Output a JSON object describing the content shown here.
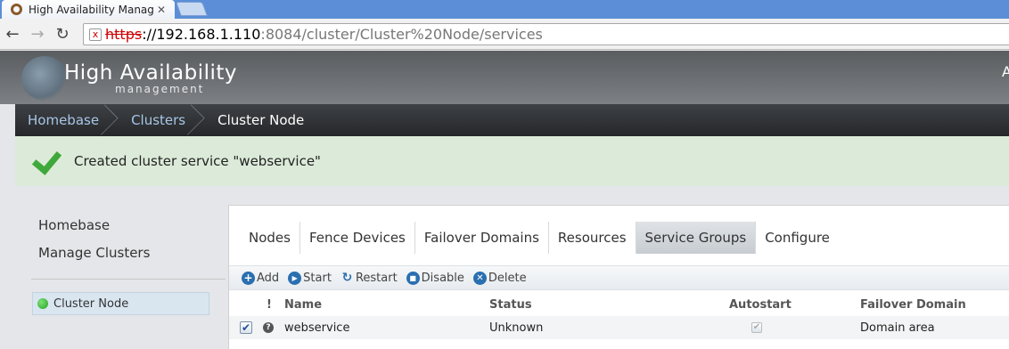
{
  "browser": {
    "tab_title": "High Availability Manag",
    "tab_close": "✕",
    "url_scheme": "https",
    "url_host": "://192.168.1.110",
    "url_path": ":8084/cluster/Cluster%20Node/services",
    "nav": {
      "back": "←",
      "forward": "→",
      "reload": "↻"
    },
    "ssl_icon": "broken-lock-icon"
  },
  "app": {
    "title": "High Availability",
    "subtitle": "management",
    "user_initial": "A"
  },
  "breadcrumb": [
    {
      "label": "Homebase"
    },
    {
      "label": "Clusters"
    },
    {
      "label": "Cluster Node"
    }
  ],
  "message": {
    "text": "Created cluster service \"webservice\"",
    "icon": "checkmark-icon",
    "color": "#3fa83b"
  },
  "leftnav": {
    "items": [
      {
        "label": "Homebase"
      },
      {
        "label": "Manage Clusters"
      }
    ],
    "cluster": {
      "label": "Cluster Node",
      "status_color": "#23a51e"
    }
  },
  "tabs": [
    {
      "label": "Nodes"
    },
    {
      "label": "Fence Devices"
    },
    {
      "label": "Failover Domains"
    },
    {
      "label": "Resources"
    },
    {
      "label": "Service Groups",
      "active": true
    },
    {
      "label": "Configure"
    }
  ],
  "actions": [
    {
      "label": "Add",
      "icon": "plus-circle-icon"
    },
    {
      "label": "Start",
      "icon": "play-circle-icon"
    },
    {
      "label": "Restart",
      "icon": "refresh-icon"
    },
    {
      "label": "Disable",
      "icon": "stop-circle-icon"
    },
    {
      "label": "Delete",
      "icon": "x-circle-icon"
    }
  ],
  "table": {
    "headers": {
      "flag": "!",
      "name": "Name",
      "status": "Status",
      "autostart": "Autostart",
      "domain": "Failover Domain"
    },
    "rows": [
      {
        "selected": true,
        "name": "webservice",
        "status": "Unknown",
        "autostart": true,
        "domain": "Domain area"
      }
    ]
  }
}
